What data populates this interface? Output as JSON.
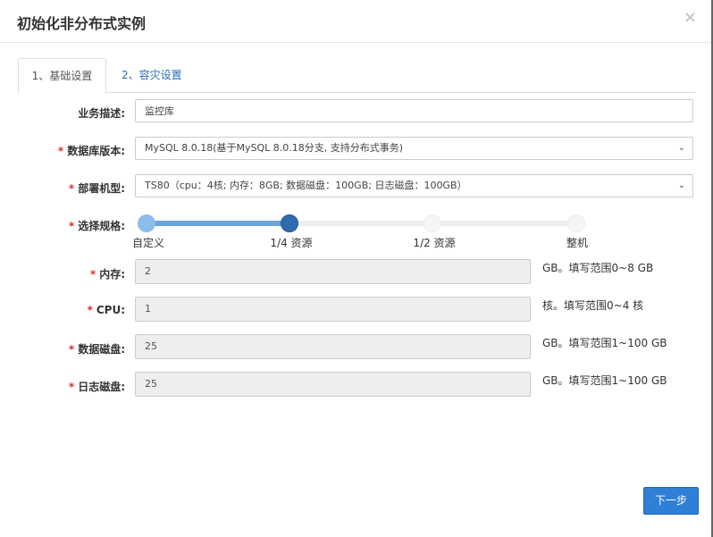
{
  "dialog": {
    "title": "初始化非分布式实例",
    "close_label": "×"
  },
  "tabs": [
    {
      "label": "1、基础设置",
      "active": true
    },
    {
      "label": "2、容灾设置",
      "active": false
    }
  ],
  "form": {
    "business_desc": {
      "label": "业务描述:",
      "value": "监控库",
      "required": false
    },
    "db_version": {
      "label": "数据库版本:",
      "value": "MySQL 8.0.18(基于MySQL 8.0.18分支, 支持分布式事务)",
      "required": true
    },
    "machine_type": {
      "label": "部署机型:",
      "value": "TS80（cpu：4核; 内存：8GB; 数据磁盘：100GB; 日志磁盘：100GB）",
      "required": true
    },
    "spec": {
      "label": "选择规格:",
      "required": true,
      "options": [
        "自定义",
        "1/4 资源",
        "1/2 资源",
        "整机"
      ],
      "selected_index": 1
    },
    "memory": {
      "label": "内存:",
      "value": "2",
      "hint": "GB。填写范围0~8 GB",
      "required": true
    },
    "cpu": {
      "label": "CPU:",
      "value": "1",
      "hint": "核。填写范围0~4 核",
      "required": true
    },
    "data_disk": {
      "label": "数据磁盘:",
      "value": "25",
      "hint": "GB。填写范围1~100 GB",
      "required": true
    },
    "log_disk": {
      "label": "日志磁盘:",
      "value": "25",
      "hint": "GB。填写范围1~100 GB",
      "required": true
    }
  },
  "footer": {
    "next_label": "下一步"
  },
  "colors": {
    "accent": "#2f7fd6",
    "required": "#d9302c",
    "slider_fill": "#6ea3dc",
    "slider_knob": "#2e6aac"
  },
  "icons": {
    "close": "close-icon",
    "select_arrow": "chevron-down-icon"
  }
}
